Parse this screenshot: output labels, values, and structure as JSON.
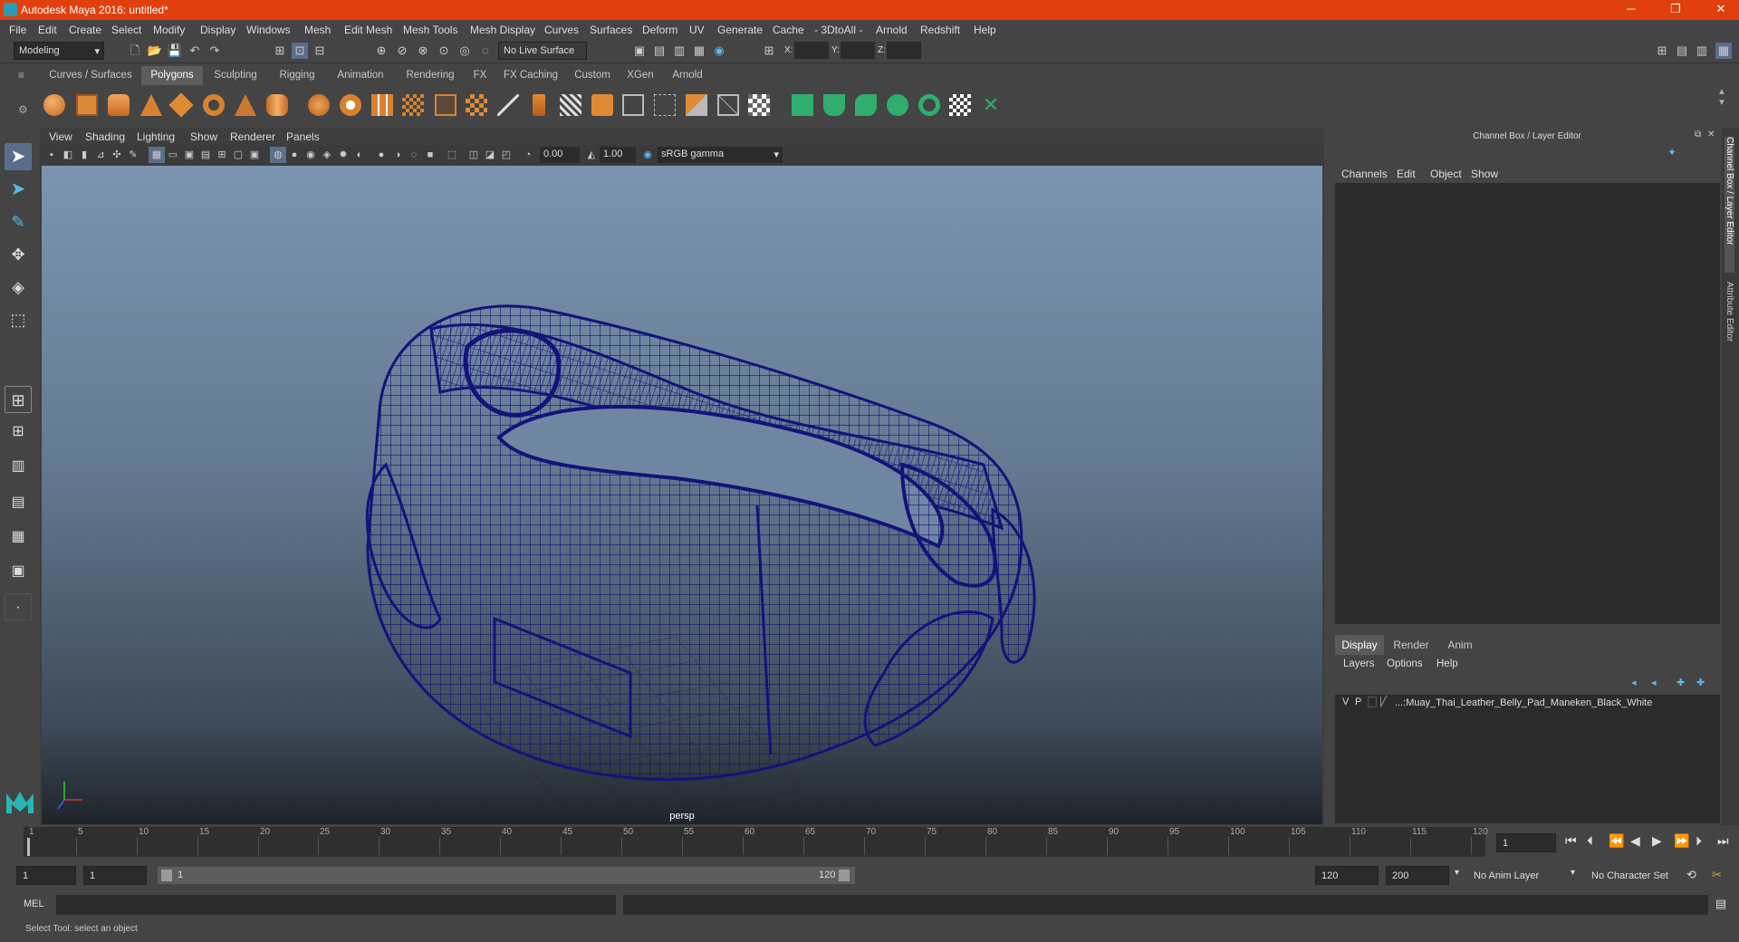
{
  "window": {
    "title": "Autodesk Maya 2016: untitled*",
    "minimize": "─",
    "restore": "❐",
    "close": "✕"
  },
  "menu": [
    "File",
    "Edit",
    "Create",
    "Select",
    "Modify",
    "Display",
    "Windows",
    "Mesh",
    "Edit Mesh",
    "Mesh Tools",
    "Mesh Display",
    "Curves",
    "Surfaces",
    "Deform",
    "UV",
    "Generate",
    "Cache",
    "- 3DtoAll -",
    "Arnold",
    "Redshift",
    "Help"
  ],
  "status": {
    "mode": "Modeling",
    "live_surface": "No Live Surface",
    "x_label": "X:",
    "y_label": "Y:",
    "z_label": "Z:"
  },
  "shelf_tabs": [
    "Curves / Surfaces",
    "Polygons",
    "Sculpting",
    "Rigging",
    "Animation",
    "Rendering",
    "FX",
    "FX Caching",
    "Custom",
    "XGen",
    "Arnold"
  ],
  "shelf_active": "Polygons",
  "viewport": {
    "menu": [
      "View",
      "Shading",
      "Lighting",
      "Show",
      "Renderer",
      "Panels"
    ],
    "exposure": "0.00",
    "gamma": "1.00",
    "color_space": "sRGB gamma",
    "camera": "persp"
  },
  "channel_box": {
    "header": "Channel Box / Layer Editor",
    "menu": [
      "Channels",
      "Edit",
      "Object",
      "Show"
    ]
  },
  "layer_editor": {
    "tabs": [
      "Display",
      "Render",
      "Anim"
    ],
    "active_tab": "Display",
    "menu": [
      "Layers",
      "Options",
      "Help"
    ],
    "layer": {
      "v": "V",
      "p": "P",
      "name": "...:Muay_Thai_Leather_Belly_Pad_Maneken_Black_White"
    }
  },
  "side_tabs": [
    "Channel Box / Layer Editor",
    "Attribute Editor"
  ],
  "timeline": {
    "ticks": [
      "1",
      "5",
      "10",
      "15",
      "20",
      "25",
      "30",
      "35",
      "40",
      "45",
      "50",
      "55",
      "60",
      "65",
      "70",
      "75",
      "80",
      "85",
      "90",
      "95",
      "100",
      "105",
      "110",
      "115",
      "120"
    ],
    "current_frame": "1"
  },
  "range": {
    "start": "1",
    "playback_start": "1",
    "slider_start": "1",
    "slider_end": "120",
    "playback_end": "120",
    "end": "200",
    "anim_layer": "No Anim Layer",
    "char_set": "No Character Set"
  },
  "command": {
    "label": "MEL"
  },
  "help": {
    "text": "Select Tool: select an object"
  },
  "colors": {
    "title": "#e0400e",
    "wire": "#13137a"
  }
}
